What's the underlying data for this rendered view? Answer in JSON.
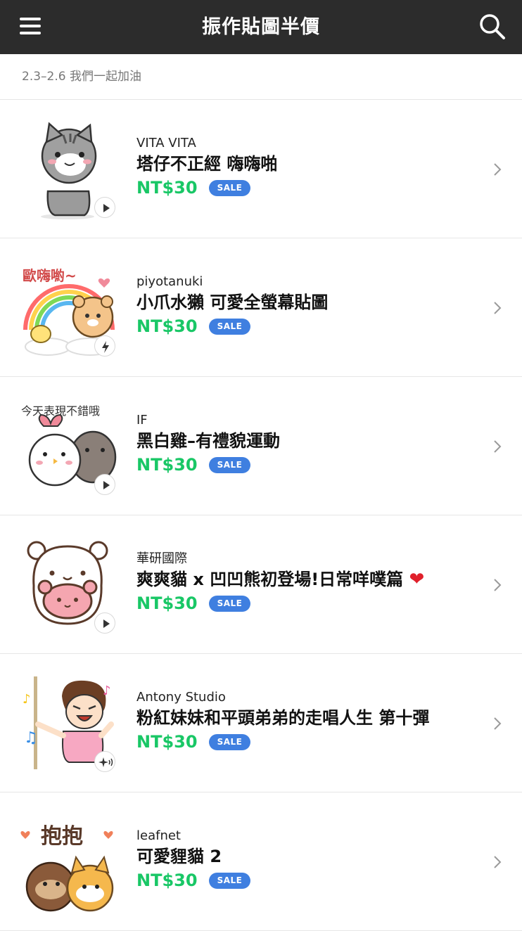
{
  "header": {
    "title": "振作貼圖半價",
    "menu_icon": "hamburger-menu-icon",
    "search_icon": "search-icon",
    "background": "#2c2c2c"
  },
  "subheader": {
    "text": "2.3–2.6 我們一起加油"
  },
  "colors": {
    "price": "#19c766",
    "sale_badge": "#3f7fe0"
  },
  "items": [
    {
      "author": "VITA VITA",
      "title": "塔仔不正經 嗨嗨啪",
      "price": "NT$30",
      "badge": "SALE",
      "type_icon": "play-icon"
    },
    {
      "author": "piyotanuki",
      "title": "小爪水獺 可愛全螢幕貼圖",
      "price": "NT$30",
      "badge": "SALE",
      "type_icon": "lightning-icon",
      "sticker_text": "歐嗨喲~"
    },
    {
      "author": "IF",
      "title": "黑白雞–有禮貌運動",
      "price": "NT$30",
      "badge": "SALE",
      "type_icon": "play-icon",
      "sticker_text": "今天表現不錯哦"
    },
    {
      "author": "華研國際",
      "title": "爽爽貓 x 凹凹熊初登場!日常咩噗篇",
      "title_emoji": "❤",
      "price": "NT$30",
      "badge": "SALE",
      "type_icon": "play-icon"
    },
    {
      "author": "Antony Studio",
      "title": "粉紅妹妹和平頭弟弟的走唱人生 第十彈",
      "price": "NT$30",
      "badge": "SALE",
      "type_icon": "sound-effect-icon"
    },
    {
      "author": "leafnet",
      "title": "可愛貍貓 2",
      "price": "NT$30",
      "badge": "SALE",
      "type_icon": "play-icon",
      "sticker_text": "抱抱"
    }
  ]
}
